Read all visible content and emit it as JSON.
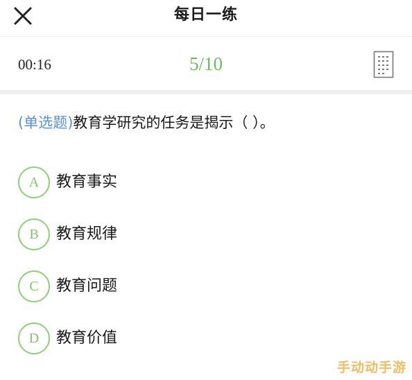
{
  "header": {
    "title": "每日一练",
    "close_icon": "close-icon"
  },
  "status": {
    "timer": "00:16",
    "progress": "5/10",
    "progress_color": "#6cbd5a",
    "answer_sheet_icon": "answer-sheet-icon"
  },
  "question": {
    "type_label": "(单选题)",
    "type_color": "#5b8fd6",
    "text": "教育学研究的任务是揭示（ ）。"
  },
  "options": [
    {
      "letter": "A",
      "text": "教育事实"
    },
    {
      "letter": "B",
      "text": "教育规律"
    },
    {
      "letter": "C",
      "text": "教育问题"
    },
    {
      "letter": "D",
      "text": "教育价值"
    }
  ],
  "option_accent_color": "#8ed07c",
  "watermark": {
    "text": "手动动手游"
  }
}
